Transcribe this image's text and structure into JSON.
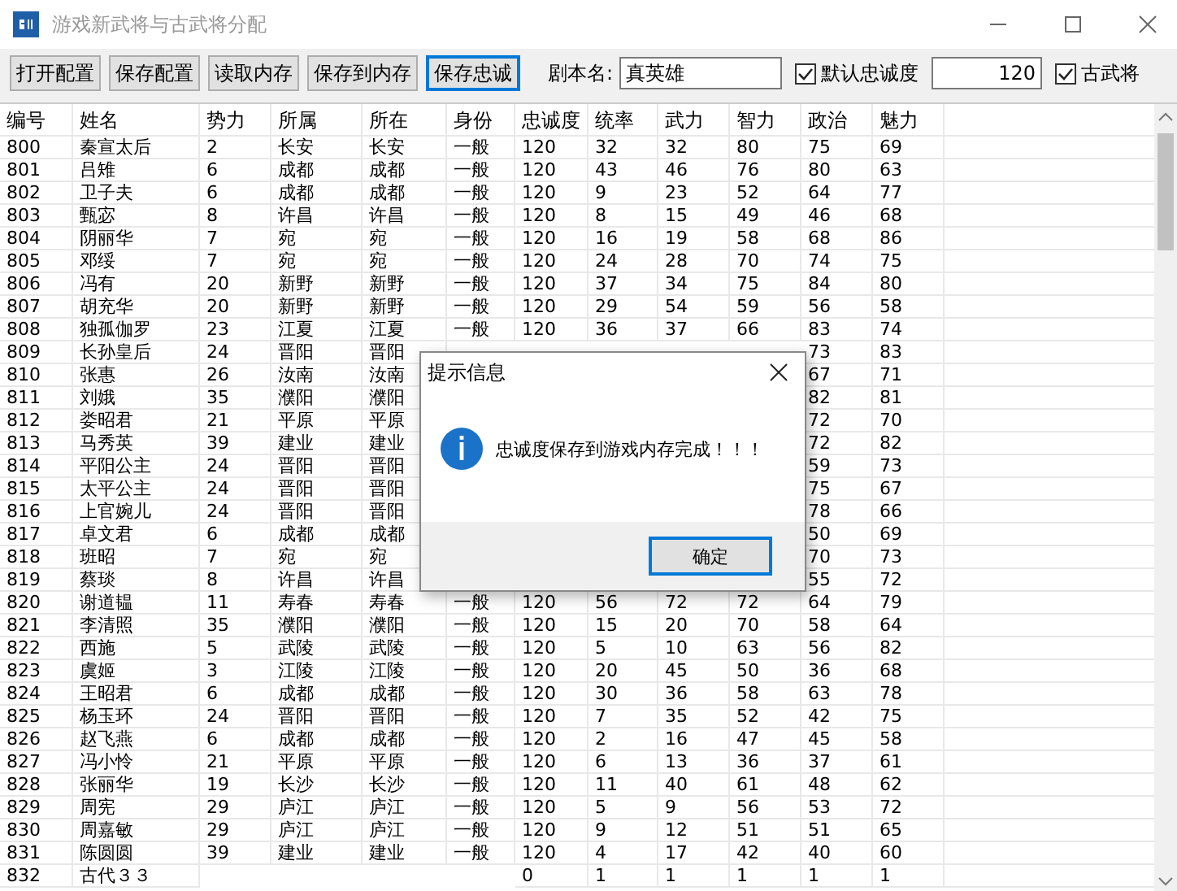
{
  "window": {
    "title": "游戏新武将与古武将分配",
    "active": false
  },
  "toolbar": {
    "buttons": [
      {
        "label": "打开配置",
        "focused": false
      },
      {
        "label": "保存配置",
        "focused": false
      },
      {
        "label": "读取内存",
        "focused": false
      },
      {
        "label": "保存到内存",
        "focused": false
      },
      {
        "label": "保存忠诚",
        "focused": true
      }
    ],
    "script_label": "剧本名:",
    "script_value": "真英雄",
    "loyalty_checkbox": {
      "label": "默认忠诚度",
      "checked": true
    },
    "loyalty_value": "120",
    "ancient_checkbox": {
      "label": "古武将",
      "checked": true
    }
  },
  "table": {
    "columns": [
      "编号",
      "姓名",
      "势力",
      "所属",
      "所在",
      "身份",
      "忠诚度",
      "统率",
      "武力",
      "智力",
      "政治",
      "魅力"
    ],
    "rows": [
      [
        "800",
        "秦宣太后",
        "2",
        "长安",
        "长安",
        "一般",
        "120",
        "32",
        "32",
        "80",
        "75",
        "69"
      ],
      [
        "801",
        "吕雉",
        "6",
        "成都",
        "成都",
        "一般",
        "120",
        "43",
        "46",
        "76",
        "80",
        "63"
      ],
      [
        "802",
        "卫子夫",
        "6",
        "成都",
        "成都",
        "一般",
        "120",
        "9",
        "23",
        "52",
        "64",
        "77"
      ],
      [
        "803",
        "甄宓",
        "8",
        "许昌",
        "许昌",
        "一般",
        "120",
        "8",
        "15",
        "49",
        "46",
        "68"
      ],
      [
        "804",
        "阴丽华",
        "7",
        "宛",
        "宛",
        "一般",
        "120",
        "16",
        "19",
        "58",
        "68",
        "86"
      ],
      [
        "805",
        "邓绥",
        "7",
        "宛",
        "宛",
        "一般",
        "120",
        "24",
        "28",
        "70",
        "74",
        "75"
      ],
      [
        "806",
        "冯有",
        "20",
        "新野",
        "新野",
        "一般",
        "120",
        "37",
        "34",
        "75",
        "84",
        "80"
      ],
      [
        "807",
        "胡充华",
        "20",
        "新野",
        "新野",
        "一般",
        "120",
        "29",
        "54",
        "59",
        "56",
        "58"
      ],
      [
        "808",
        "独孤伽罗",
        "23",
        "江夏",
        "江夏",
        "一般",
        "120",
        "36",
        "37",
        "66",
        "83",
        "74"
      ],
      [
        "809",
        "长孙皇后",
        "24",
        "晋阳",
        "晋阳",
        null,
        null,
        null,
        null,
        null,
        "73",
        "83"
      ],
      [
        "810",
        "张惠",
        "26",
        "汝南",
        "汝南",
        null,
        null,
        null,
        null,
        null,
        "67",
        "71"
      ],
      [
        "811",
        "刘娥",
        "35",
        "濮阳",
        "濮阳",
        null,
        null,
        null,
        null,
        null,
        "82",
        "81"
      ],
      [
        "812",
        "娄昭君",
        "21",
        "平原",
        "平原",
        null,
        null,
        null,
        null,
        null,
        "72",
        "70"
      ],
      [
        "813",
        "马秀英",
        "39",
        "建业",
        "建业",
        null,
        null,
        null,
        null,
        null,
        "72",
        "82"
      ],
      [
        "814",
        "平阳公主",
        "24",
        "晋阳",
        "晋阳",
        null,
        null,
        null,
        null,
        null,
        "59",
        "73"
      ],
      [
        "815",
        "太平公主",
        "24",
        "晋阳",
        "晋阳",
        null,
        null,
        null,
        null,
        null,
        "75",
        "67"
      ],
      [
        "816",
        "上官婉儿",
        "24",
        "晋阳",
        "晋阳",
        null,
        null,
        null,
        null,
        null,
        "78",
        "66"
      ],
      [
        "817",
        "卓文君",
        "6",
        "成都",
        "成都",
        null,
        null,
        null,
        null,
        null,
        "50",
        "69"
      ],
      [
        "818",
        "班昭",
        "7",
        "宛",
        "宛",
        null,
        null,
        null,
        null,
        null,
        "70",
        "73"
      ],
      [
        "819",
        "蔡琰",
        "8",
        "许昌",
        "许昌",
        null,
        null,
        null,
        null,
        null,
        "55",
        "72"
      ],
      [
        "820",
        "谢道韫",
        "11",
        "寿春",
        "寿春",
        "一般",
        "120",
        "56",
        "72",
        "72",
        "64",
        "79"
      ],
      [
        "821",
        "李清照",
        "35",
        "濮阳",
        "濮阳",
        "一般",
        "120",
        "15",
        "20",
        "70",
        "58",
        "64"
      ],
      [
        "822",
        "西施",
        "5",
        "武陵",
        "武陵",
        "一般",
        "120",
        "5",
        "10",
        "63",
        "56",
        "82"
      ],
      [
        "823",
        "虞姬",
        "3",
        "江陵",
        "江陵",
        "一般",
        "120",
        "20",
        "45",
        "50",
        "36",
        "68"
      ],
      [
        "824",
        "王昭君",
        "6",
        "成都",
        "成都",
        "一般",
        "120",
        "30",
        "36",
        "58",
        "63",
        "78"
      ],
      [
        "825",
        "杨玉环",
        "24",
        "晋阳",
        "晋阳",
        "一般",
        "120",
        "7",
        "35",
        "52",
        "42",
        "75"
      ],
      [
        "826",
        "赵飞燕",
        "6",
        "成都",
        "成都",
        "一般",
        "120",
        "2",
        "16",
        "47",
        "45",
        "58"
      ],
      [
        "827",
        "冯小怜",
        "21",
        "平原",
        "平原",
        "一般",
        "120",
        "6",
        "13",
        "36",
        "37",
        "61"
      ],
      [
        "828",
        "张丽华",
        "19",
        "长沙",
        "长沙",
        "一般",
        "120",
        "11",
        "40",
        "61",
        "48",
        "62"
      ],
      [
        "829",
        "周宪",
        "29",
        "庐江",
        "庐江",
        "一般",
        "120",
        "5",
        "9",
        "56",
        "53",
        "72"
      ],
      [
        "830",
        "周嘉敏",
        "29",
        "庐江",
        "庐江",
        "一般",
        "120",
        "9",
        "12",
        "51",
        "51",
        "65"
      ],
      [
        "831",
        "陈圆圆",
        "39",
        "建业",
        "建业",
        "一般",
        "120",
        "4",
        "17",
        "42",
        "40",
        "60"
      ],
      [
        "832",
        "古代３３",
        null,
        null,
        null,
        null,
        "0",
        "1",
        "1",
        "1",
        "1",
        "1"
      ]
    ]
  },
  "dialog": {
    "title": "提示信息",
    "message": "忠诚度保存到游戏内存完成！！！",
    "button": "确定"
  }
}
